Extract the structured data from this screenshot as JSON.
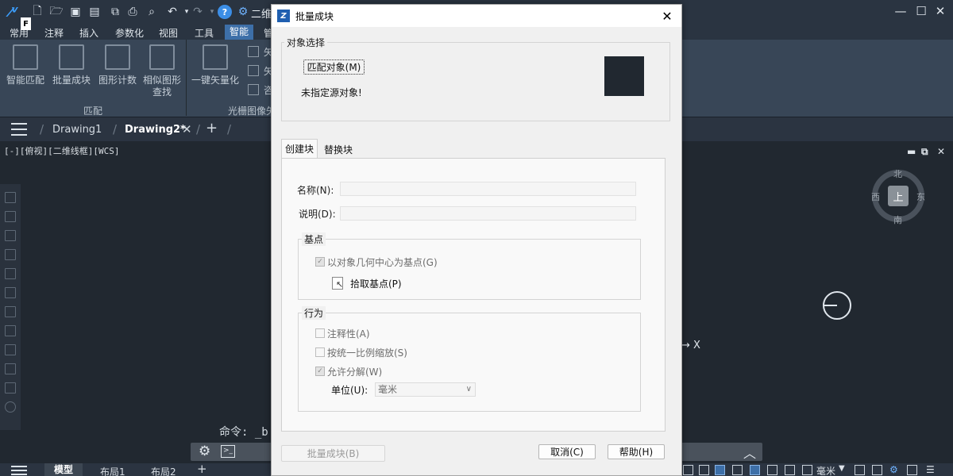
{
  "app": {
    "quick_access_badge": "F",
    "workspace_label": "二维",
    "icons": [
      "app-logo-icon",
      "new-file-icon",
      "open-folder-icon",
      "save-icon",
      "save-as-icon",
      "copy-icon",
      "print-icon",
      "print-preview-icon",
      "undo-icon",
      "redo-icon",
      "help-icon",
      "gear-icon"
    ]
  },
  "ribbon": {
    "tabs": [
      "常用",
      "注释",
      "插入",
      "参数化",
      "视图",
      "工具",
      "智能",
      "管"
    ],
    "active_tab": "智能",
    "buttons": [
      "智能匹配",
      "批量成块",
      "图形计数",
      "相似图形",
      "一键矢量化"
    ],
    "similar_second_line": "查找",
    "small_buttons": [
      "矢",
      "矢",
      "咨"
    ],
    "group_labels": [
      "匹配",
      "光栅图像矢"
    ]
  },
  "doc_tabs": {
    "tabs": [
      "Drawing1",
      "Drawing2*"
    ],
    "active": "Drawing2*",
    "add_label": "+"
  },
  "canvas": {
    "viewport_label": "[-][俯视][二维线框][WCS]",
    "compass": {
      "north": "北",
      "south": "南",
      "east": "东",
      "west": "西",
      "top": "上"
    },
    "axis_label": "X",
    "arrow_label": "→"
  },
  "command": {
    "prompt": "命令: _b",
    "terminal_label": ">_"
  },
  "status": {
    "tabs": [
      "模型",
      "布局1",
      "布局2"
    ],
    "active": "模型",
    "add_label": "+",
    "unit_label": "毫米"
  },
  "dialog": {
    "title": "批量成块",
    "close_label": "✕",
    "object_section": {
      "legend": "对象选择",
      "match_button": "匹配对象(M)",
      "status_text": "未指定源对象!"
    },
    "tabs": [
      "创建块",
      "替换块"
    ],
    "active_tab": "创建块",
    "create_block": {
      "name_label": "名称(N):",
      "name_value": "",
      "desc_label": "说明(D):",
      "desc_value": "",
      "basepoint": {
        "legend": "基点",
        "center_checkbox": "以对象几何中心为基点(G)",
        "center_checked": true,
        "pick_label": "拾取基点(P)"
      },
      "behavior": {
        "legend": "行为",
        "annotative": "注释性(A)",
        "annotative_checked": false,
        "uniform_scale": "按统一比例缩放(S)",
        "uniform_scale_checked": false,
        "allow_explode": "允许分解(W)",
        "allow_explode_checked": true,
        "unit_label": "单位(U):",
        "unit_value": "毫米"
      }
    },
    "footer": {
      "batch_button": "批量成块(B)",
      "cancel_button": "取消(C)",
      "help_button": "帮助(H)"
    }
  }
}
